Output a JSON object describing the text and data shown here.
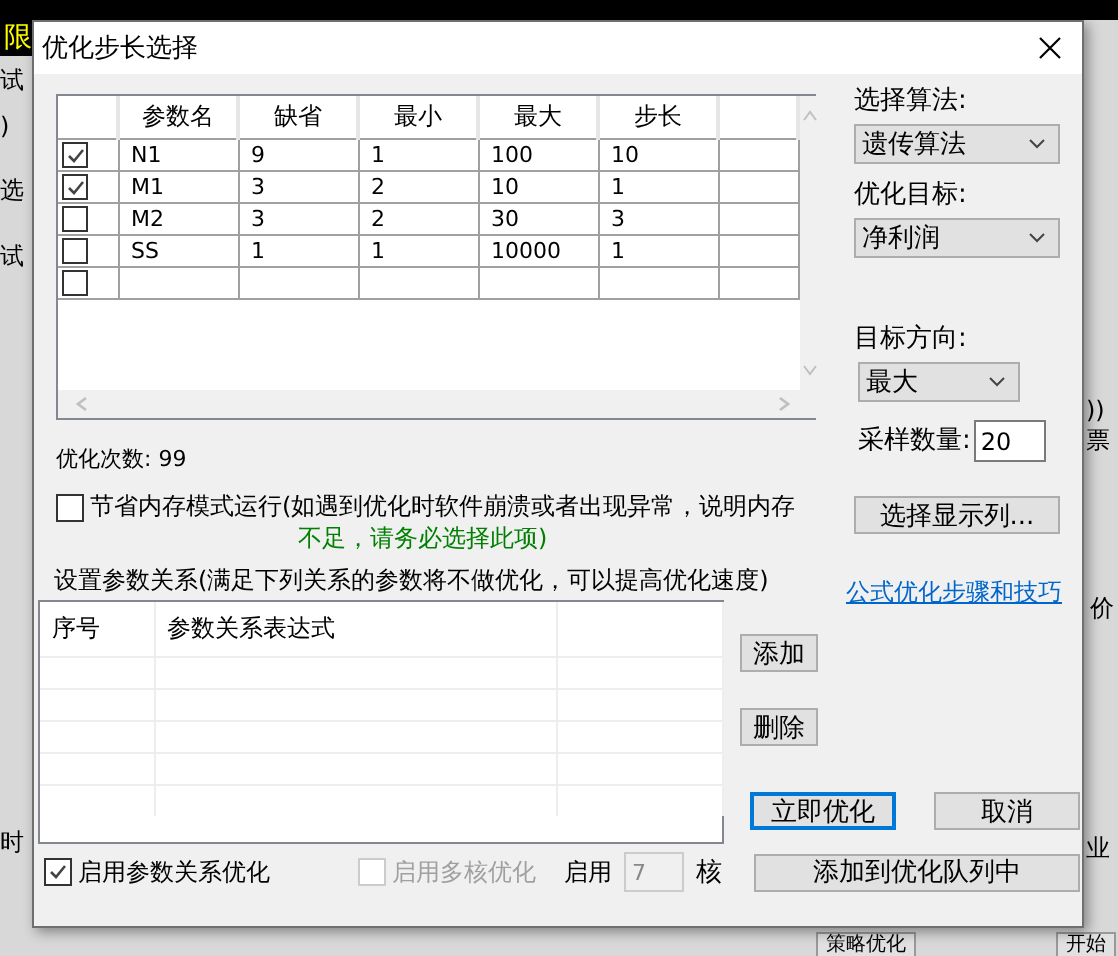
{
  "background": {
    "left": [
      "限",
      "试",
      ")",
      "选",
      "试",
      "时"
    ],
    "right": [
      "))",
      "票",
      "价",
      "业"
    ],
    "bottom": [
      "策略优化",
      "开始"
    ]
  },
  "window": {
    "title": "优化步长选择"
  },
  "param_table": {
    "columns": [
      "参数名",
      "缺省",
      "最小",
      "最大",
      "步长"
    ],
    "rows": [
      {
        "checked": true,
        "cells": [
          "N1",
          "9",
          "1",
          "100",
          "10"
        ]
      },
      {
        "checked": true,
        "cells": [
          "M1",
          "3",
          "2",
          "10",
          "1"
        ]
      },
      {
        "checked": false,
        "cells": [
          "M2",
          "3",
          "2",
          "30",
          "3"
        ]
      },
      {
        "checked": false,
        "cells": [
          "SS",
          "1",
          "1",
          "10000",
          "1"
        ]
      },
      {
        "checked": false
      }
    ]
  },
  "optimization_count": "优化次数: 99",
  "memory_saving": {
    "checked": false,
    "label": "节省内存模式运行(如遇到优化时软件崩溃或者出现异常，说明内存",
    "warning": "不足，请务必选择此项)"
  },
  "settings": {
    "algorithm_label": "选择算法:",
    "algorithm": "遗传算法",
    "target_label": "优化目标:",
    "target": "净利润",
    "direction_label": "目标方向:",
    "direction": "最大",
    "samples_label": "采样数量:",
    "samples": "20",
    "columns_button": "选择显示列..."
  },
  "relations": {
    "caption": "设置参数关系(满足下列关系的参数将不做优化，可以提高优化速度)",
    "link": "公式优化步骤和技巧",
    "columns": [
      "序号",
      "参数关系表达式"
    ],
    "buttons": [
      "添加",
      "删除"
    ]
  },
  "actions": [
    {
      "label": "立即优化",
      "default": true
    },
    {
      "label": "取消",
      "default": false
    }
  ],
  "queue_button": "添加到优化队列中",
  "options": {
    "relation_opt": {
      "label": "启用参数关系优化",
      "checked": true,
      "disabled": false
    },
    "multicore": {
      "label": "启用多核优化",
      "checked": false,
      "disabled": true
    },
    "cores_label": "启用",
    "cores_value": "7",
    "cores_disabled": true,
    "cores_unit": "核"
  }
}
